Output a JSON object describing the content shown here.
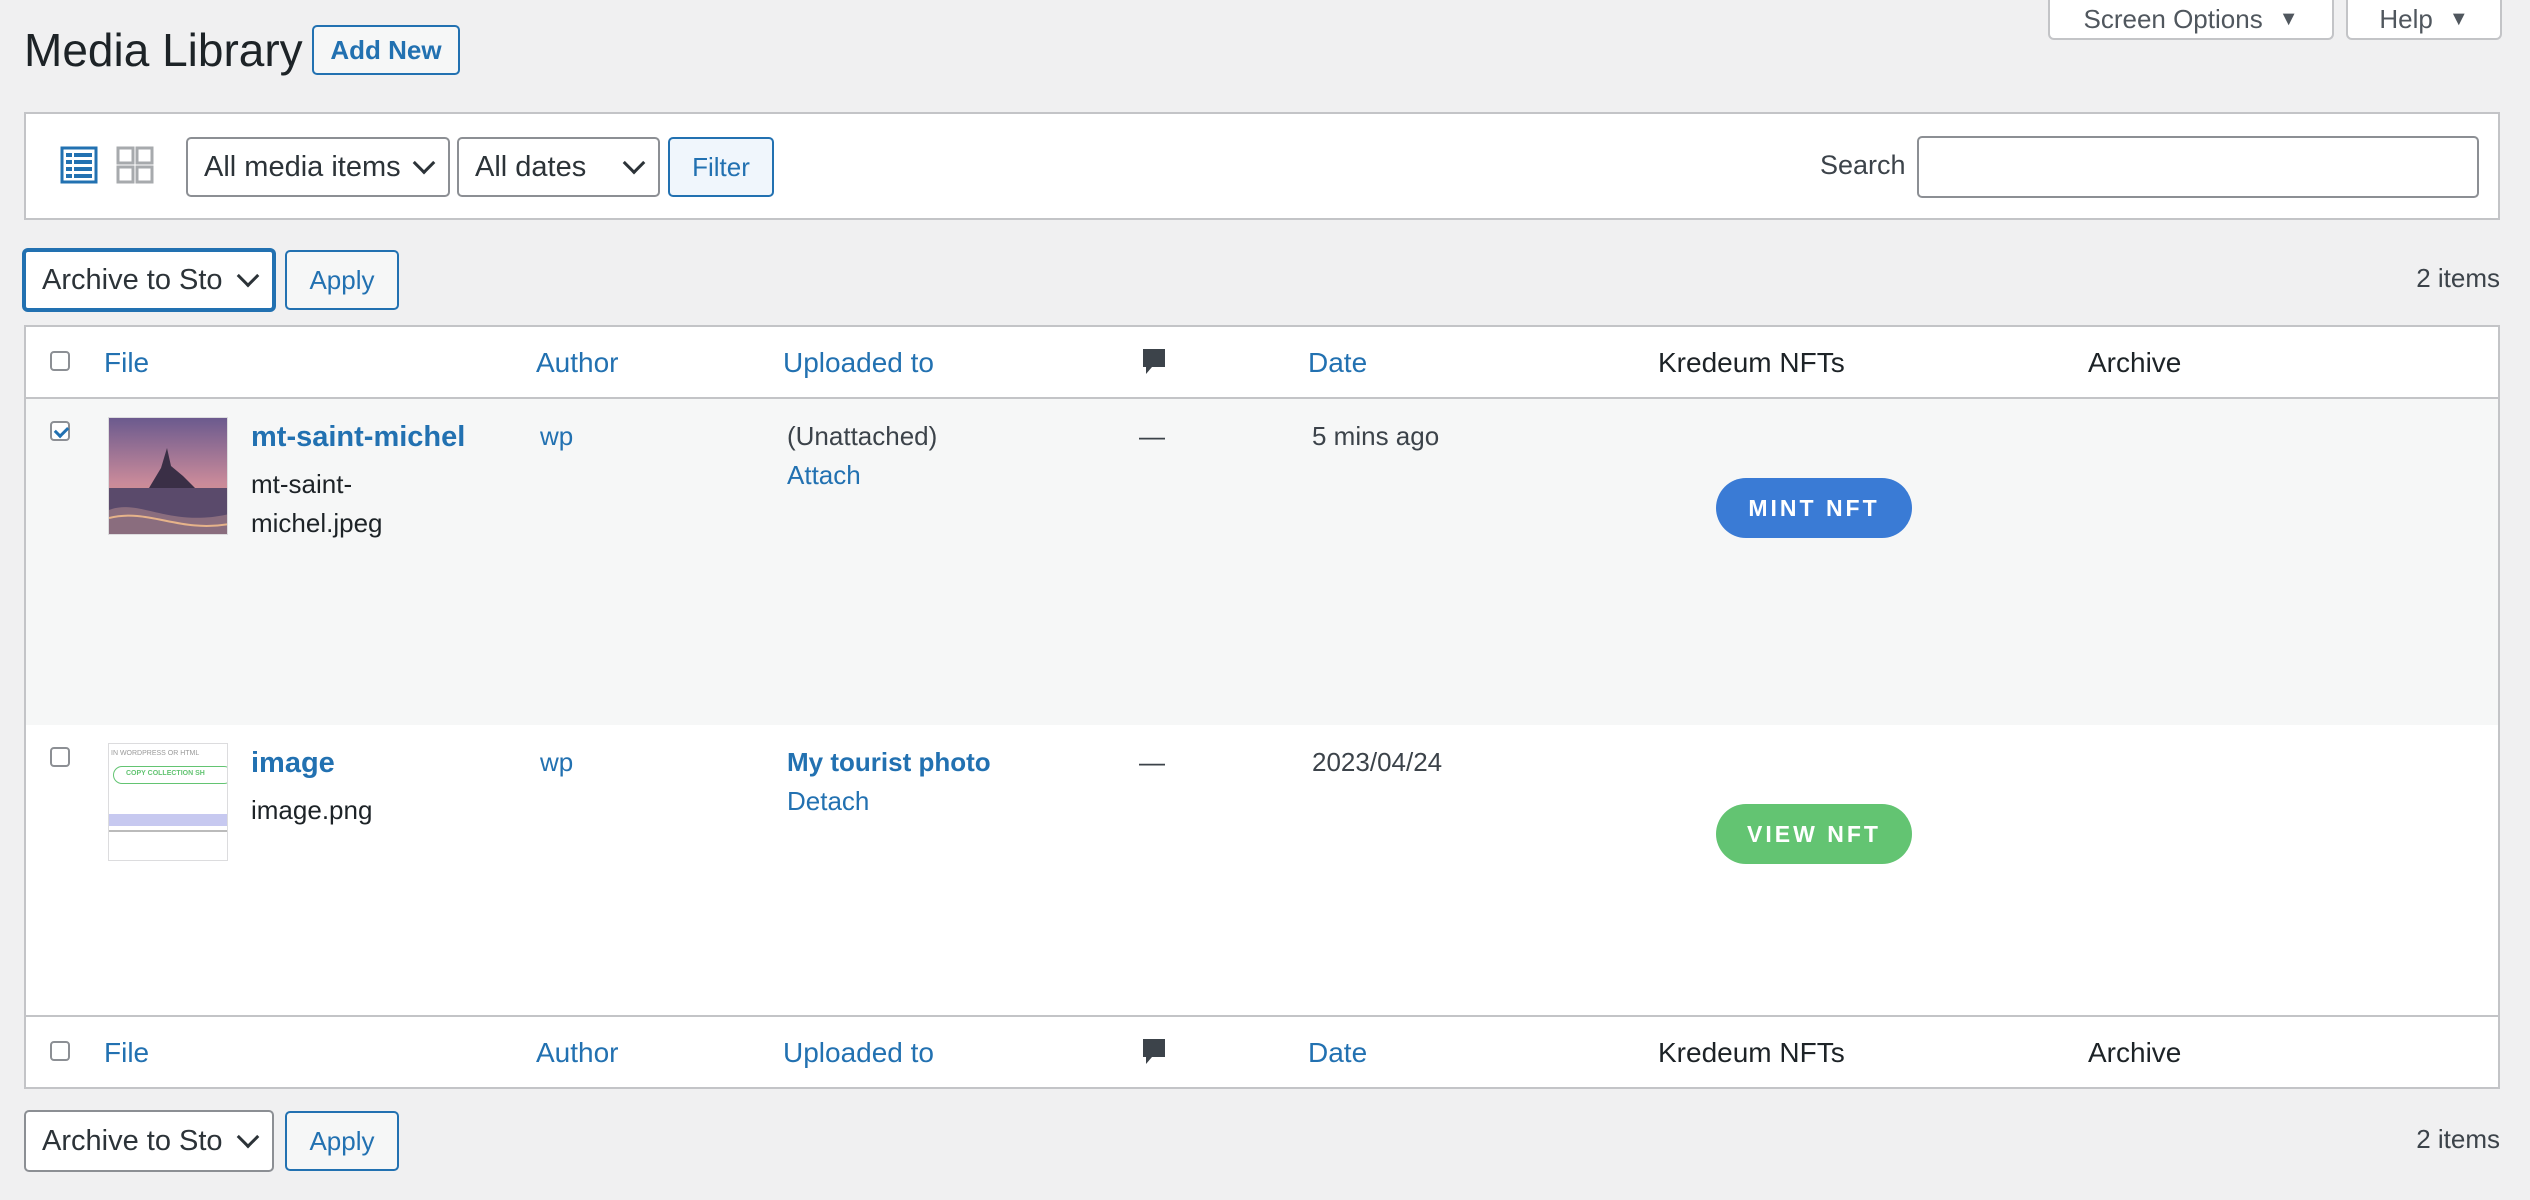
{
  "header": {
    "title": "Media Library",
    "add_new_label": "Add New",
    "screen_options_label": "Screen Options",
    "help_label": "Help"
  },
  "filter_bar": {
    "media_type_selected": "All media items",
    "date_selected": "All dates",
    "filter_label": "Filter",
    "search_label": "Search",
    "search_value": ""
  },
  "bulk_actions": {
    "top_selected": "Archive to Sto",
    "bottom_selected": "Archive to Sto",
    "apply_label": "Apply",
    "items_count": "2 items"
  },
  "table": {
    "columns": {
      "file": "File",
      "author": "Author",
      "uploaded_to": "Uploaded to",
      "comments_icon": "comment-icon",
      "date": "Date",
      "nfts": "Kredeum NFTs",
      "archive": "Archive"
    },
    "rows": [
      {
        "checked": true,
        "title": "mt-saint-michel",
        "filename_line1": "mt-saint-",
        "filename_line2": "michel.jpeg",
        "author": "wp",
        "uploaded_to": "(Unattached)",
        "uploaded_action": "Attach",
        "comments": "—",
        "date": "5 mins ago",
        "nft_button": "MINT NFT",
        "nft_color": "#3a7bd5"
      },
      {
        "checked": false,
        "title": "image",
        "filename_line1": "image.png",
        "author": "wp",
        "uploaded_to": "My tourist photo",
        "uploaded_action": "Detach",
        "comments": "—",
        "date": "2023/04/24",
        "nft_button": "VIEW NFT",
        "nft_color": "#63c472",
        "thumb_texts": {
          "line1": "IN WORDPRESS OR HTML",
          "button": "COPY COLLECTION SH"
        }
      }
    ]
  },
  "colors": {
    "accent": "#2271b1",
    "background": "#f0f0f1",
    "mint": "#3a7bd5",
    "view": "#63c472"
  }
}
